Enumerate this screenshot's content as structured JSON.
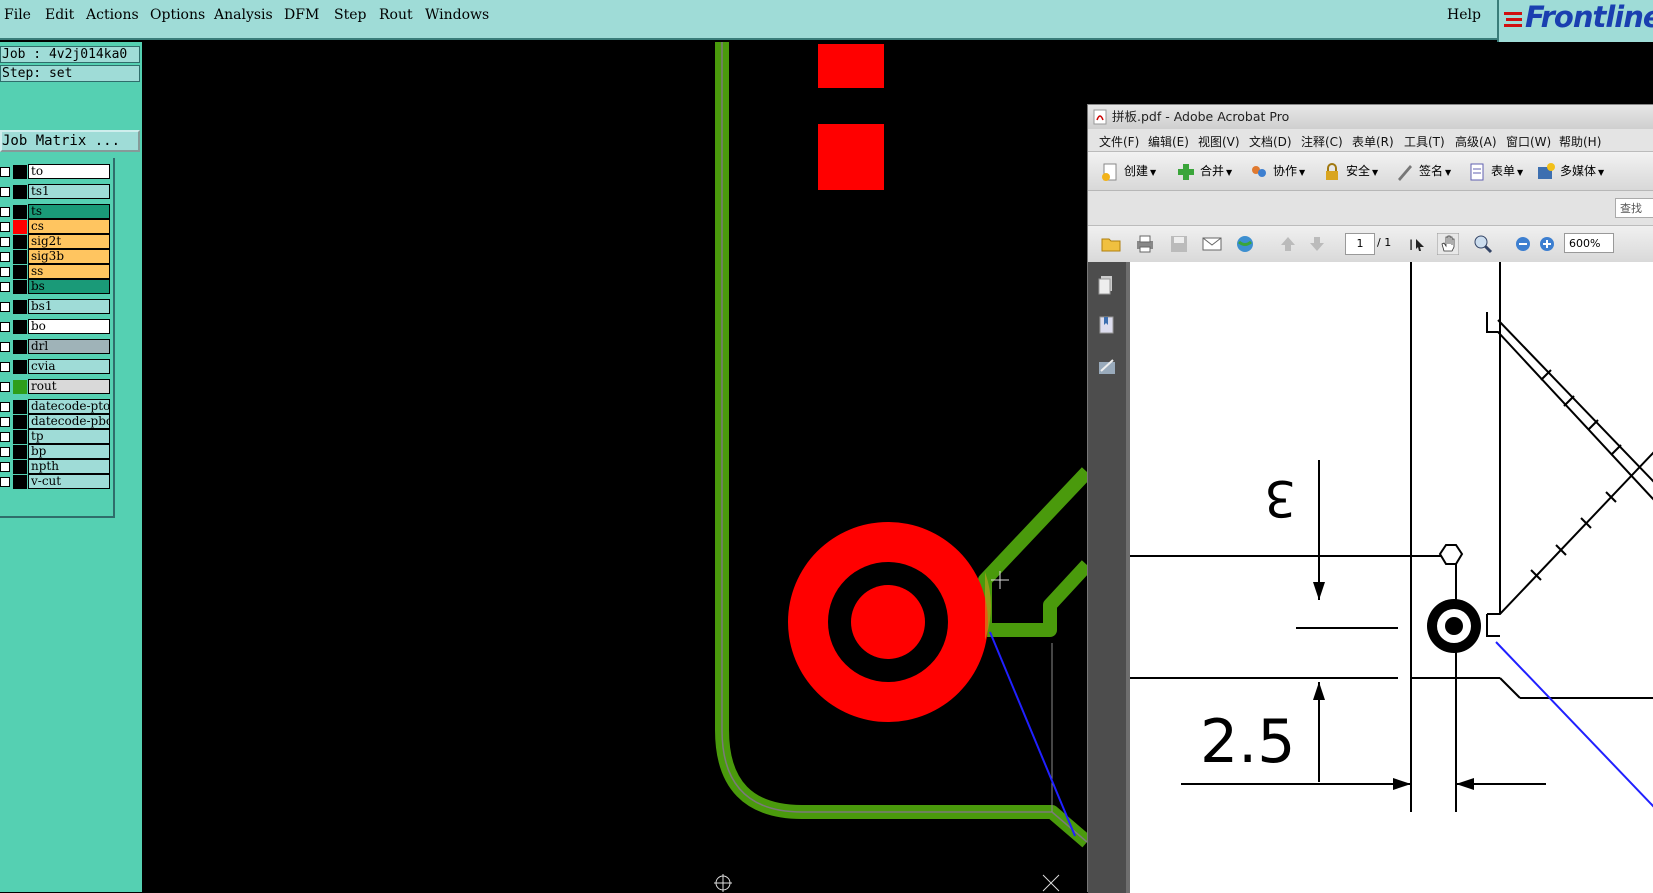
{
  "menubar": {
    "items": [
      "File",
      "Edit",
      "Actions",
      "Options",
      "Analysis",
      "DFM",
      "Step",
      "Rout",
      "Windows"
    ],
    "help": "Help"
  },
  "logo": {
    "text": "Frontline"
  },
  "left_panel": {
    "job": "Job : 4v2j014ka0",
    "step": "Step: set",
    "job_matrix": "Job Matrix ...",
    "layers": [
      {
        "name": "to",
        "bg": "#ffffff",
        "swatch": "#000000"
      },
      {
        "name": "ts1",
        "bg": "#9fdcd7",
        "swatch": "#000000"
      },
      {
        "name": "ts",
        "bg": "#1a9a78",
        "swatch": "#000000"
      },
      {
        "name": "cs",
        "bg": "#ffc560",
        "swatch": "#ff0000"
      },
      {
        "name": "sig2t",
        "bg": "#ffc560",
        "swatch": "#000000"
      },
      {
        "name": "sig3b",
        "bg": "#ffc560",
        "swatch": "#000000"
      },
      {
        "name": "ss",
        "bg": "#ffc560",
        "swatch": "#000000"
      },
      {
        "name": "bs",
        "bg": "#1a9a78",
        "swatch": "#000000"
      },
      {
        "name": "bs1",
        "bg": "#9fdcd7",
        "swatch": "#000000"
      },
      {
        "name": "bo",
        "bg": "#ffffff",
        "swatch": "#000000"
      },
      {
        "name": "drl",
        "bg": "#9fb3b8",
        "swatch": "#000000"
      },
      {
        "name": "cvia",
        "bg": "#9fdcd7",
        "swatch": "#000000"
      },
      {
        "name": "rout",
        "bg": "#d9d9d9",
        "swatch": "#2e9e1a"
      },
      {
        "name": "datecode-pto",
        "bg": "#9fdcd7",
        "swatch": "#000000"
      },
      {
        "name": "datecode-pbo",
        "bg": "#9fdcd7",
        "swatch": "#000000"
      },
      {
        "name": "tp",
        "bg": "#9fdcd7",
        "swatch": "#000000"
      },
      {
        "name": "bp",
        "bg": "#9fdcd7",
        "swatch": "#000000"
      },
      {
        "name": "npth",
        "bg": "#9fdcd7",
        "swatch": "#000000"
      },
      {
        "name": "v-cut",
        "bg": "#9fdcd7",
        "swatch": "#000000"
      }
    ]
  },
  "acrobat": {
    "title": "拼板.pdf - Adobe Acrobat Pro",
    "menu": [
      "文件(F)",
      "编辑(E)",
      "视图(V)",
      "文档(D)",
      "注释(C)",
      "表单(R)",
      "工具(T)",
      "高级(A)",
      "窗口(W)",
      "帮助(H)"
    ],
    "toolbar": [
      "创建",
      "合并",
      "协作",
      "安全",
      "签名",
      "表单",
      "多媒体"
    ],
    "search_label": "查找",
    "page_current": "1",
    "page_total": "/ 1",
    "zoom": "600%"
  },
  "drawing": {
    "dim_top": "3",
    "dim_bottom": "2.5"
  },
  "colors": {
    "pad": "#ff0000",
    "rout": "#4a9a0c",
    "panel": "#55d0b2",
    "menubar": "#9fdcd7"
  }
}
